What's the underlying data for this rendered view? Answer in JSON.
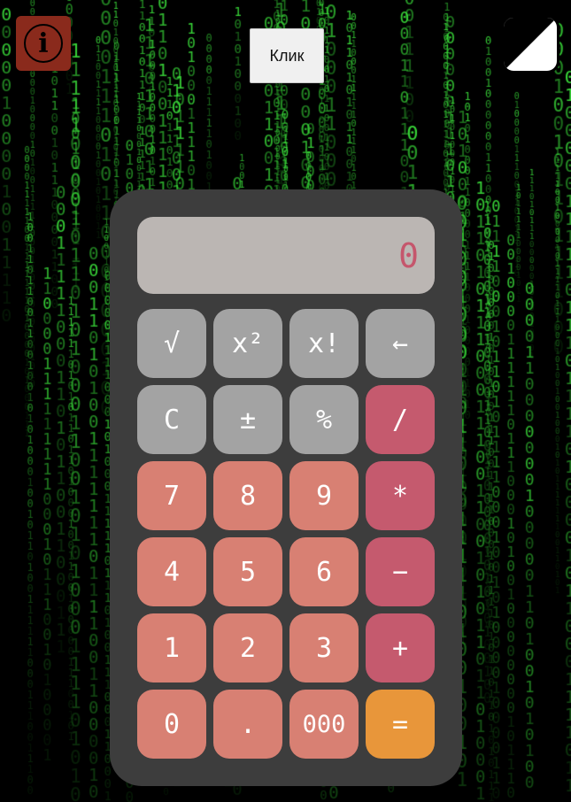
{
  "header": {
    "info_icon_glyph": "i",
    "klik_label": "Клик"
  },
  "calculator": {
    "display_value": "0",
    "keys": [
      {
        "label": "√",
        "kind": "fn",
        "name": "sqrt-button"
      },
      {
        "label": "x²",
        "kind": "fn",
        "name": "square-button"
      },
      {
        "label": "x!",
        "kind": "fn",
        "name": "factorial-button"
      },
      {
        "label": "←",
        "kind": "fn",
        "name": "backspace-button"
      },
      {
        "label": "C",
        "kind": "fn",
        "name": "clear-button"
      },
      {
        "label": "±",
        "kind": "fn",
        "name": "negate-button"
      },
      {
        "label": "%",
        "kind": "fn",
        "name": "percent-button"
      },
      {
        "label": "/",
        "kind": "op",
        "name": "divide-button"
      },
      {
        "label": "7",
        "kind": "num",
        "name": "digit-7-button"
      },
      {
        "label": "8",
        "kind": "num",
        "name": "digit-8-button"
      },
      {
        "label": "9",
        "kind": "num",
        "name": "digit-9-button"
      },
      {
        "label": "*",
        "kind": "op",
        "name": "multiply-button"
      },
      {
        "label": "4",
        "kind": "num",
        "name": "digit-4-button"
      },
      {
        "label": "5",
        "kind": "num",
        "name": "digit-5-button"
      },
      {
        "label": "6",
        "kind": "num",
        "name": "digit-6-button"
      },
      {
        "label": "−",
        "kind": "op",
        "name": "subtract-button"
      },
      {
        "label": "1",
        "kind": "num",
        "name": "digit-1-button"
      },
      {
        "label": "2",
        "kind": "num",
        "name": "digit-2-button"
      },
      {
        "label": "3",
        "kind": "num",
        "name": "digit-3-button"
      },
      {
        "label": "+",
        "kind": "op",
        "name": "add-button"
      },
      {
        "label": "0",
        "kind": "num",
        "name": "digit-0-button"
      },
      {
        "label": ".",
        "kind": "num",
        "name": "decimal-button"
      },
      {
        "label": "000",
        "kind": "num",
        "name": "triple-zero-button"
      },
      {
        "label": "=",
        "kind": "eq",
        "name": "equals-button"
      }
    ]
  },
  "colors": {
    "matrix_green": "#3be03b",
    "calc_body": "#3d3d3d",
    "display_bg": "#bbb6b3",
    "display_text": "#c5566c",
    "fn_key": "#a3a3a3",
    "num_key": "#d88073",
    "op_key": "#c55a6e",
    "eq_key": "#e8963a",
    "info_button": "#8a2a1c"
  }
}
